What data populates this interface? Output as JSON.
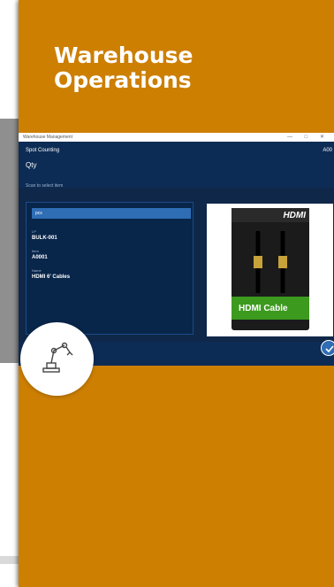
{
  "card": {
    "title_line1": "Warehouse",
    "title_line2": "Operations",
    "background": "#cd7f02"
  },
  "screenshot": {
    "window_title": "Warehouse Management",
    "window_controls": "—  □  ✕",
    "app_name": "Spot Counting",
    "right_label": "A00",
    "field_title": "Qty",
    "scan_hint": "Scan to select item",
    "selected_item": "pcs",
    "fields": [
      {
        "label": "LP",
        "value": "BULK-001"
      },
      {
        "label": "Item",
        "value": "A0001"
      },
      {
        "label": "Name",
        "value": "HDMI 6' Cables"
      }
    ],
    "product": {
      "brand": "HDMI",
      "name": "HDMI Cable"
    }
  },
  "icons": {
    "badge": "robot-arm-icon",
    "confirm": "check-icon"
  }
}
